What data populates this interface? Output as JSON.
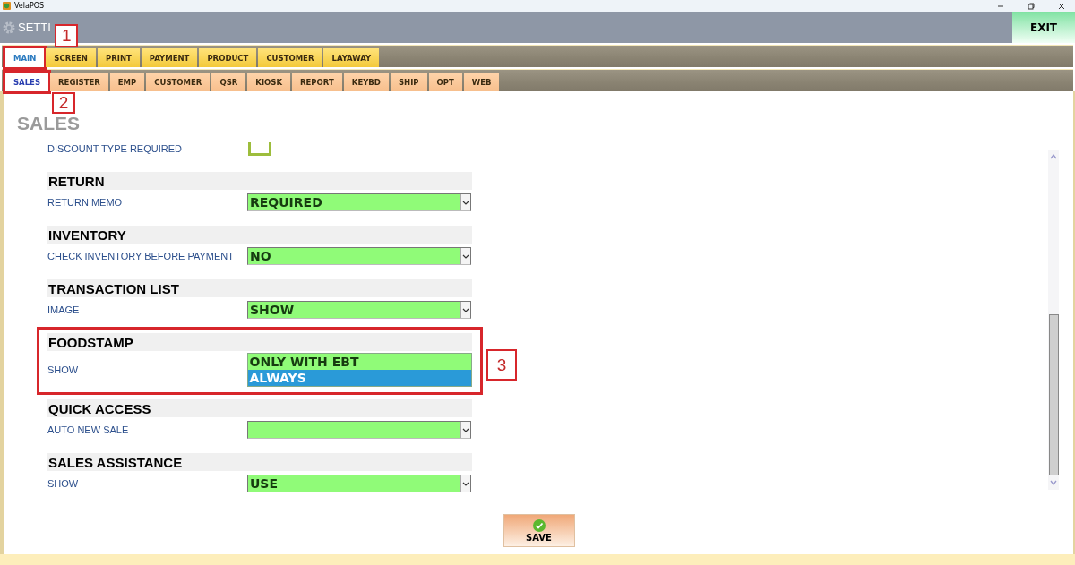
{
  "window": {
    "title": "VelaPOS"
  },
  "header": {
    "title": "SETTI",
    "exit": "EXIT"
  },
  "main_tabs": [
    {
      "label": "MAIN",
      "selected": true,
      "annotation": "1"
    },
    {
      "label": "SCREEN",
      "selected": false
    },
    {
      "label": "PRINT",
      "selected": false
    },
    {
      "label": "PAYMENT",
      "selected": false
    },
    {
      "label": "PRODUCT",
      "selected": false
    },
    {
      "label": "CUSTOMER",
      "selected": false
    },
    {
      "label": "LAYAWAY",
      "selected": false
    }
  ],
  "sub_tabs": [
    {
      "label": "SALES",
      "selected": true,
      "annotation": "2"
    },
    {
      "label": "REGISTER",
      "selected": false
    },
    {
      "label": "EMP",
      "selected": false
    },
    {
      "label": "CUSTOMER",
      "selected": false
    },
    {
      "label": "QSR",
      "selected": false
    },
    {
      "label": "KIOSK",
      "selected": false
    },
    {
      "label": "REPORT",
      "selected": false
    },
    {
      "label": "KEYBD",
      "selected": false
    },
    {
      "label": "SHIP",
      "selected": false
    },
    {
      "label": "OPT",
      "selected": false
    },
    {
      "label": "WEB",
      "selected": false
    }
  ],
  "page_title": "SALES",
  "sections": [
    {
      "rows": [
        {
          "label": "DISCOUNT TYPE REQUIRED",
          "kind": "checkbox",
          "checked": false
        }
      ]
    },
    {
      "title": "RETURN",
      "rows": [
        {
          "label": "RETURN MEMO",
          "kind": "select",
          "value": "REQUIRED"
        }
      ]
    },
    {
      "title": "INVENTORY",
      "rows": [
        {
          "label": "CHECK INVENTORY BEFORE PAYMENT",
          "kind": "select",
          "value": "NO"
        }
      ]
    },
    {
      "title": "TRANSACTION LIST",
      "rows": [
        {
          "label": "IMAGE",
          "kind": "select",
          "value": "SHOW"
        }
      ]
    },
    {
      "title": "FOODSTAMP",
      "annotation": "3",
      "rows": [
        {
          "label": "SHOW",
          "kind": "open-select",
          "options": [
            {
              "label": "ONLY WITH EBT",
              "selected": false
            },
            {
              "label": "ALWAYS",
              "selected": true
            }
          ]
        }
      ]
    },
    {
      "title": "QUICK ACCESS",
      "rows": [
        {
          "label": "AUTO NEW SALE",
          "kind": "select"
        }
      ]
    },
    {
      "title": "SALES ASSISTANCE",
      "rows": [
        {
          "label": "SHOW",
          "kind": "select",
          "value": "USE"
        }
      ]
    }
  ],
  "save": "SAVE"
}
